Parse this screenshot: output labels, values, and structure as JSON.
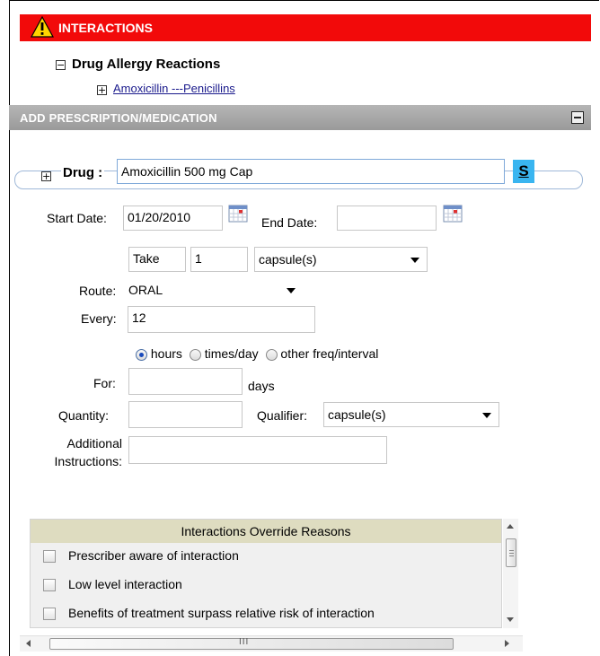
{
  "interactions": {
    "title": "INTERACTIONS",
    "tree_toggle": "−",
    "allergy_title": "Drug Allergy Reactions",
    "allergy_item_toggle": "+",
    "allergy_item": "Amoxicillin ---Penicillins"
  },
  "prescription": {
    "header": "ADD PRESCRIPTION/MEDICATION",
    "drug_toggle": "+",
    "drug_label": "Drug :",
    "drug_value": "Amoxicillin 500 mg Cap",
    "s_button": "S",
    "start_date_label": "Start Date:",
    "start_date_value": "01/20/2010",
    "end_date_label": "End Date:",
    "end_date_value": "",
    "take_label": "Take",
    "take_qty": "1",
    "take_unit": "capsule(s)",
    "route_label": "Route:",
    "route_value": "ORAL",
    "every_label": "Every:",
    "every_value": "12",
    "freq_options": [
      "hours",
      "times/day",
      "other freq/interval"
    ],
    "freq_selected": "hours",
    "for_label": "For:",
    "for_value": "",
    "days_label": "days",
    "quantity_label": "Quantity:",
    "quantity_value": "",
    "qualifier_label": "Qualifier:",
    "qualifier_value": "capsule(s)",
    "additional_label_1": "Additional",
    "additional_label_2": "Instructions:",
    "additional_value": ""
  },
  "override": {
    "header": "Interactions Override Reasons",
    "reasons": [
      "Prescriber aware of interaction",
      "Low level interaction",
      "Benefits of treatment surpass relative risk of interaction"
    ]
  },
  "scroll": {
    "h_thumb_grip": "III"
  }
}
